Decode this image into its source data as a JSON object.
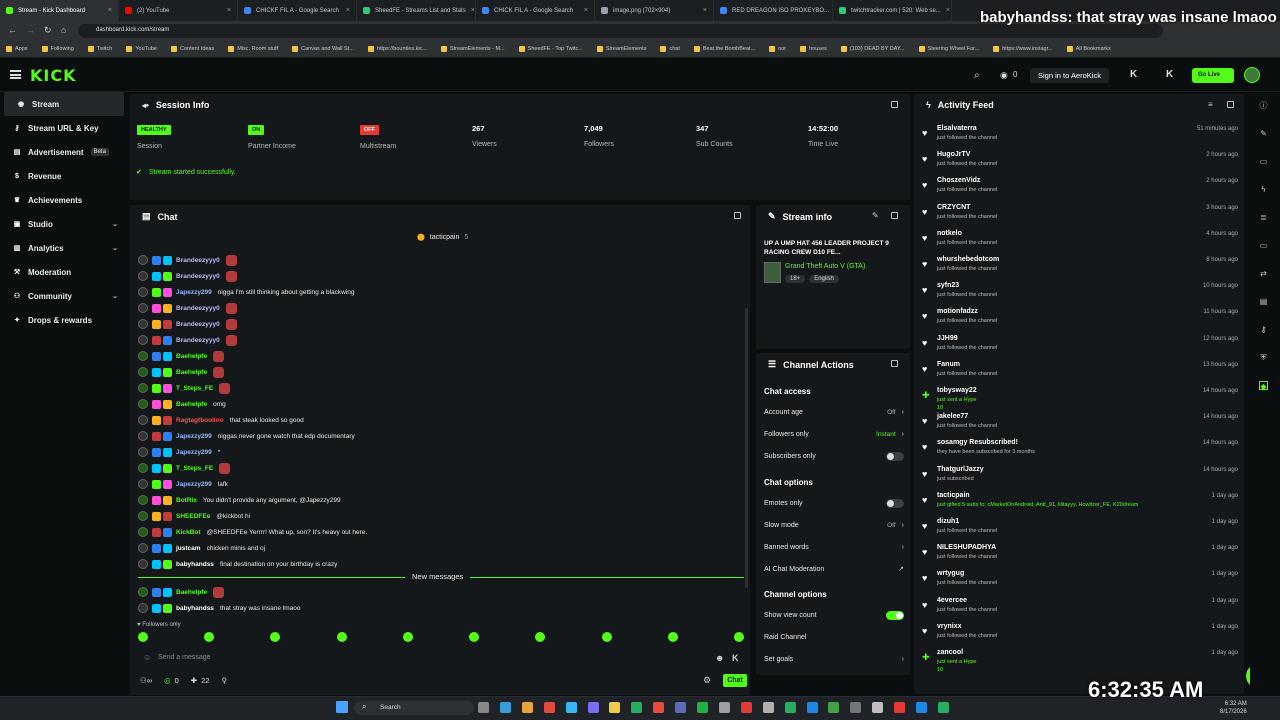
{
  "browser": {
    "tabs": [
      {
        "label": "Stream - Kick Dashboard",
        "color": "#53fc18",
        "active": true
      },
      {
        "label": "(2) YouTube",
        "color": "#ff0000"
      },
      {
        "label": "CHICKF FIL A - Google Search",
        "color": "#4285f4"
      },
      {
        "label": "SheedFE - Streams List and Stats",
        "color": "#2ecc71"
      },
      {
        "label": "CHICK FIL A - Google Search",
        "color": "#4285f4"
      },
      {
        "label": "image.png (702×904)",
        "color": "#9aa0a6"
      },
      {
        "label": "RED DREAGON ISO PROKEYBO...",
        "color": "#4285f4"
      },
      {
        "label": "twitchtracker.com | 520: Web se...",
        "color": "#2ecc71"
      }
    ],
    "url": "dashboard.kick.com/stream",
    "bookmarks": [
      "Apps",
      "Following",
      "Twitch",
      "YouTube",
      "Content Ideas",
      "Misc. Room stuff",
      "Canvas and Wall St...",
      "https://bounties.kic...",
      "StreamElements - M...",
      "SheedFE - Top Twitc...",
      "StreamElements",
      "chat",
      "Beat the BombBeat...",
      "oor",
      "houses",
      "(103) DEAD BY DAY...",
      "Steering Wheel For...",
      "https://www.instagr...",
      "All Bookmarks"
    ],
    "overlay_text": "babyhandss:  that stray was insane lmaoo"
  },
  "topnav": {
    "logo": "KICK",
    "signin": "Sign in to AeroKick",
    "golive": "Go Live",
    "notif_count": "0"
  },
  "sidebar": {
    "items": [
      {
        "label": "Stream",
        "icon": "broadcast-icon",
        "active": true
      },
      {
        "label": "Stream URL & Key",
        "icon": "key-icon"
      },
      {
        "label": "Advertisement",
        "icon": "ad-icon",
        "badge": "Beta"
      },
      {
        "label": "Revenue",
        "icon": "dollar-icon"
      },
      {
        "label": "Achievements",
        "icon": "trophy-icon"
      },
      {
        "label": "Studio",
        "icon": "studio-icon",
        "chevron": true
      },
      {
        "label": "Analytics",
        "icon": "analytics-icon",
        "chevron": true
      },
      {
        "label": "Moderation",
        "icon": "hammer-icon"
      },
      {
        "label": "Community",
        "icon": "community-icon",
        "chevron": true
      },
      {
        "label": "Drops & rewards",
        "icon": "gift-icon"
      }
    ]
  },
  "session": {
    "title": "Session Info",
    "stats": [
      {
        "badge": "HEALTHY",
        "badge_color": "#53fc18",
        "label": "Session"
      },
      {
        "badge": "ON",
        "badge_color": "#53fc18",
        "label": "Partner Income"
      },
      {
        "badge": "OFF",
        "badge_color": "#e53935",
        "label": "Multistream"
      },
      {
        "value": "267",
        "label": "Viewers"
      },
      {
        "value": "7,049",
        "label": "Followers"
      },
      {
        "value": "347",
        "label": "Sub Counts"
      },
      {
        "value": "14:52:00",
        "label": "Time Live"
      }
    ],
    "success": "Stream started successfully."
  },
  "chat": {
    "title": "Chat",
    "pinned_user": "tacticpain",
    "pinned_count": "5",
    "messages": [
      {
        "user": "Brandeezyyy0",
        "color": "#b8b8ff",
        "text": ""
      },
      {
        "user": "Brandeezyyy0",
        "color": "#b8b8ff",
        "text": ""
      },
      {
        "user": "Japezzy299",
        "color": "#8fb6ff",
        "text": "nigga I'm still thinking about getting a blackwing"
      },
      {
        "user": "Brandeezyyy0",
        "color": "#b8b8ff",
        "text": ""
      },
      {
        "user": "Brandeezyyy0",
        "color": "#b8b8ff",
        "text": ""
      },
      {
        "user": "Brandeezyyy0",
        "color": "#b8b8ff",
        "text": ""
      },
      {
        "user": "Baehelpfe",
        "color": "#53fc18",
        "text": ""
      },
      {
        "user": "Baehelpfe",
        "color": "#53fc18",
        "text": ""
      },
      {
        "user": "T_Steps_FE",
        "color": "#53fc18",
        "text": ""
      },
      {
        "user": "Baehelpfe",
        "color": "#53fc18",
        "text": "omg"
      },
      {
        "user": "Ragtagtboolino",
        "color": "#ff4d4d",
        "text": "that steak looked so good"
      },
      {
        "user": "Japezzy299",
        "color": "#8fb6ff",
        "text": "niggas never gone watch that edp documentary"
      },
      {
        "user": "Japezzy299",
        "color": "#8fb6ff",
        "text": "*"
      },
      {
        "user": "T_Steps_FE",
        "color": "#53fc18",
        "text": ""
      },
      {
        "user": "Japezzy299",
        "color": "#8fb6ff",
        "text": "lafk"
      },
      {
        "user": "BotRix",
        "color": "#53fc18",
        "text": "You didn't provide any argument, @Japezzy299"
      },
      {
        "user": "SHEEDFEe",
        "color": "#53fc18",
        "text": "@kickbot hi"
      },
      {
        "user": "KickBot",
        "color": "#53fc18",
        "text": "@SHEEDFEe Yerrrr! What up, son? It's heavy out here."
      },
      {
        "user": "justcam",
        "color": "#ffffff",
        "text": "chicken minis and oj"
      },
      {
        "user": "babyhandss",
        "color": "#ffffff",
        "text": "final destination on your birthday is crazy"
      }
    ],
    "new_messages_label": "New messages",
    "new": [
      {
        "user": "Baehelpfe",
        "color": "#53fc18",
        "text": ""
      },
      {
        "user": "babyhandss",
        "color": "#ffffff",
        "text": "that stray was insane lmaoo"
      }
    ],
    "followers_only": "Followers only",
    "placeholder": "Send a message",
    "footer_counts": {
      "a": "0",
      "b": "22"
    },
    "send_label": "Chat"
  },
  "stream_info": {
    "title": "Stream info",
    "stream_title": "UP A UMP HAT 456 LEADER PROJECT 9 RACING CREW D10 FE...",
    "category": "Grand Theft Auto V (GTA)",
    "tags": [
      "18+",
      "English"
    ]
  },
  "channel_actions": {
    "title": "Channel Actions",
    "chat_access": "Chat access",
    "account_age": {
      "label": "Account age",
      "value": "Off"
    },
    "followers_only": {
      "label": "Followers only",
      "value": "Instant"
    },
    "subscribers_only": {
      "label": "Subscribers only"
    },
    "chat_options": "Chat options",
    "emotes_only": {
      "label": "Emotes only"
    },
    "slow_mode": {
      "label": "Slow mode",
      "value": "Off"
    },
    "banned_words": {
      "label": "Banned words"
    },
    "ai_mod": {
      "label": "AI Chat Moderation"
    },
    "channel_options": "Channel options",
    "show_view_count": {
      "label": "Show view count"
    },
    "raid_channel": {
      "label": "Raid Channel"
    },
    "set_goals": {
      "label": "Set goals"
    }
  },
  "activity": {
    "title": "Activity Feed",
    "items": [
      {
        "name": "Elsalvaterra",
        "sub": "just followed the channel",
        "time": "51 minutes ago"
      },
      {
        "name": "HugoJrTV",
        "sub": "just followed the channel",
        "time": "2 hours ago"
      },
      {
        "name": "ChoszenVidz",
        "sub": "just followed the channel",
        "time": "2 hours ago"
      },
      {
        "name": "CRZYCNT",
        "sub": "just followed the channel",
        "time": "3 hours ago"
      },
      {
        "name": "notkelo",
        "sub": "just followed the channel",
        "time": "4 hours ago"
      },
      {
        "name": "whurshebedotcom",
        "sub": "just followed the channel",
        "time": "8 hours ago"
      },
      {
        "name": "syfn23",
        "sub": "just followed the channel",
        "time": "10 hours ago"
      },
      {
        "name": "motionfadzz",
        "sub": "just followed the channel",
        "time": "11 hours ago"
      },
      {
        "name": "JJH99",
        "sub": "just followed the channel",
        "time": "12 hours ago"
      },
      {
        "name": "Fanum",
        "sub": "just followed the channel",
        "time": "13 hours ago"
      },
      {
        "name": "tobysway22",
        "sub": "just sent a Hype",
        "time": "14 hours ago",
        "extra": "10"
      },
      {
        "name": "jakelee77",
        "sub": "just followed the channel",
        "time": "14 hours ago"
      },
      {
        "name": "sosamgy Resubscribed!",
        "sub": "they have been subscribed for 3 months",
        "time": "14 hours ago"
      },
      {
        "name": "ThatgurlJazzy",
        "sub": "just subscribed",
        "time": "14 hours ago"
      },
      {
        "name": "tacticpain",
        "sub": "just gifted 5 subs to: cMarketOnAndroid, Antt_91, lilitayyy, Howitzer_FE, K20dream",
        "time": "1 day ago"
      },
      {
        "name": "dizuh1",
        "sub": "just followed the channel",
        "time": "1 day ago"
      },
      {
        "name": "NILESHUPADHYA",
        "sub": "just followed the channel",
        "time": "1 day ago"
      },
      {
        "name": "wrtygug",
        "sub": "just followed the channel",
        "time": "1 day ago"
      },
      {
        "name": "4evercee",
        "sub": "just followed the channel",
        "time": "1 day ago"
      },
      {
        "name": "vrynixx",
        "sub": "just followed the channel",
        "time": "1 day ago"
      },
      {
        "name": "zancool",
        "sub": "just sent a Hype",
        "time": "1 day ago",
        "extra": "10"
      }
    ]
  },
  "taskbar": {
    "search": "Search",
    "clock_big": "6:32:35 AM",
    "clock_small": "6:32 AM",
    "date": "8/17/2026"
  }
}
